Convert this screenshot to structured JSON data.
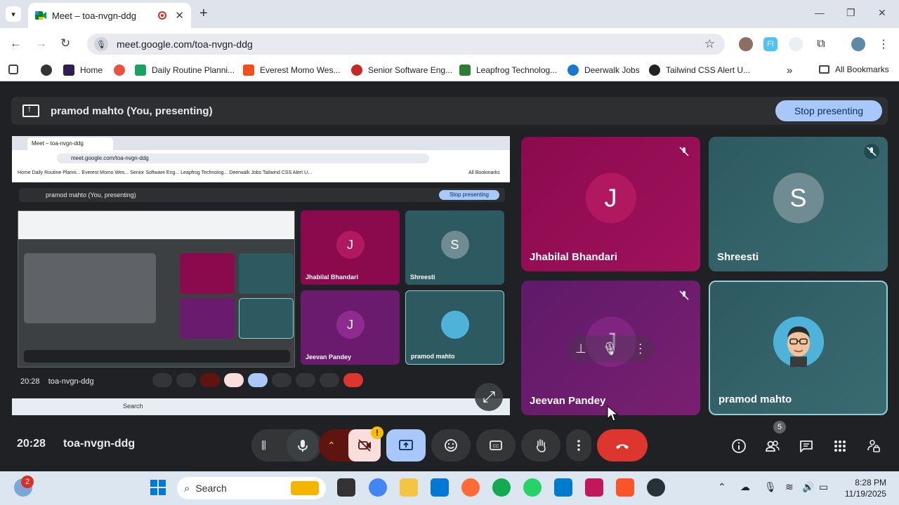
{
  "browser": {
    "tab_title": "Meet – toa-nvgn-ddg",
    "url": "meet.google.com/toa-nvgn-ddg",
    "bookmarks": [
      "Home",
      "Daily Routine Planni...",
      "Everest Momo Wes...",
      "Senior Software Eng...",
      "Leapfrog Technolog...",
      "Deerwalk Jobs",
      "Tailwind CSS Alert U..."
    ],
    "all_bookmarks": "All Bookmarks",
    "more": "»"
  },
  "presenting": {
    "text": "pramod mahto (You, presenting)",
    "stop_label": "Stop presenting"
  },
  "shared_screen": {
    "tab_title": "Meet – toa-nvgn-ddg",
    "url": "meet.google.com/toa-nvgn-ddg",
    "bookmarks": "Home     Daily Routine Planni...     Everest Momo Wes...     Senior Software Eng...     Leapfrog Technolog...     Deerwalk Jobs     Tailwind CSS Alert U...",
    "all_bookmarks": "All Bookmarks",
    "present_text": "pramod mahto (You, presenting)",
    "stop_label": "Stop presenting",
    "time": "20:28",
    "code": "toa-nvgn-ddg",
    "taskbar_search": "Search",
    "tiles": [
      {
        "name": "Jhabilal Bhandari",
        "initial": "J"
      },
      {
        "name": "Shreesti",
        "initial": "S"
      },
      {
        "name": "Jeevan Pandey",
        "initial": "J"
      },
      {
        "name": "pramod mahto",
        "initial": ""
      }
    ]
  },
  "participants": [
    {
      "name": "Jhabilal Bhandari",
      "initial": "J",
      "muted": true
    },
    {
      "name": "Shreesti",
      "initial": "S",
      "muted": true
    },
    {
      "name": "Jeevan Pandey",
      "initial": "J",
      "muted": true
    },
    {
      "name": "pramod mahto",
      "initial": "",
      "muted": false
    }
  ],
  "meeting": {
    "time": "20:28",
    "code": "toa-nvgn-ddg",
    "people_count": "5",
    "camera_warning": "!"
  },
  "taskbar": {
    "search": "Search",
    "time": "8:28 PM",
    "date": "11/19/2025",
    "weather_badge": "2"
  },
  "colors": {
    "meet_bg": "#202124",
    "tile_magenta": "#8b0a4e",
    "tile_teal": "#2d5a60",
    "tile_purple": "#6a1b6e",
    "stop_btn": "#a8c7fa",
    "end_call": "#dc362e",
    "present_btn": "#a8c7fa",
    "cam_off": "#f9dedc"
  }
}
